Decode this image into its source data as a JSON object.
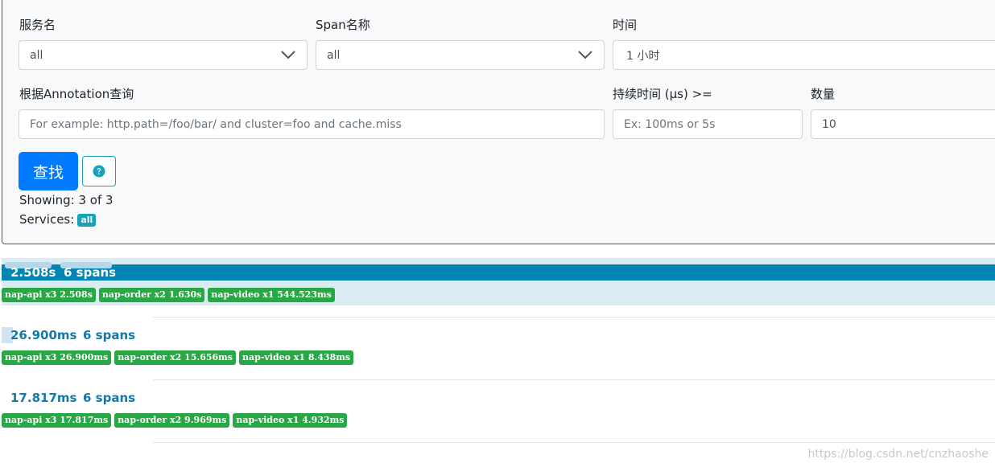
{
  "form": {
    "service_label": "服务名",
    "service_value": "all",
    "span_label": "Span名称",
    "span_value": "all",
    "time_label": "时间",
    "time_value": "1 小时",
    "annotation_label": "根据Annotation查询",
    "annotation_placeholder": "For example: http.path=/foo/bar/ and cluster=foo and cache.miss",
    "duration_label": "持续时间 (μs) >=",
    "duration_placeholder": "Ex: 100ms or 5s",
    "limit_label": "数量",
    "limit_value": "10",
    "find_button": "查找",
    "help_icon": "question-circle-icon"
  },
  "summary": {
    "showing": "Showing: 3 of 3",
    "services_label": "Services:",
    "services_badge": "all"
  },
  "traces": [
    {
      "duration": "2.508s",
      "spans": "6 spans",
      "relative_width": 1.0,
      "selected": true,
      "services": [
        "nap-api x3 2.508s",
        "nap-order x2 1.630s",
        "nap-video x1 544.523ms"
      ]
    },
    {
      "duration": "26.900ms",
      "spans": "6 spans",
      "relative_width": 0.0107,
      "selected": false,
      "services": [
        "nap-api x3 26.900ms",
        "nap-order x2 15.656ms",
        "nap-video x1 8.438ms"
      ]
    },
    {
      "duration": "17.817ms",
      "spans": "6 spans",
      "relative_width": 0.0071,
      "selected": false,
      "services": [
        "nap-api x3 17.817ms",
        "nap-order x2 9.969ms",
        "nap-video x1 4.932ms"
      ]
    }
  ],
  "watermark": "https://blog.csdn.net/cnzhaoshe",
  "colors": {
    "primary": "#007bff",
    "info": "#17a2b8",
    "success": "#28a745",
    "trace_bar": "#0185b5",
    "trace_bg": "#d9ecf4",
    "trace_text": "#1279ad"
  }
}
